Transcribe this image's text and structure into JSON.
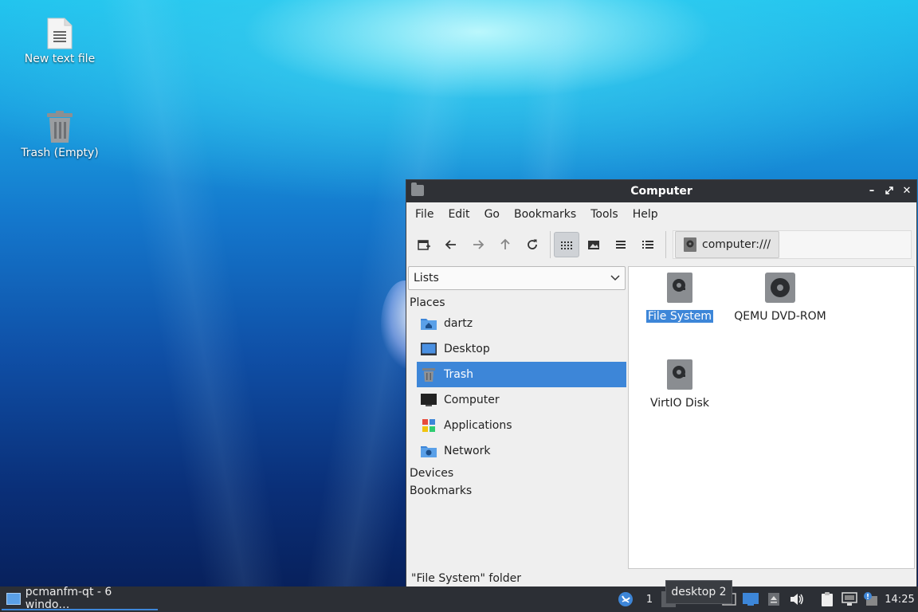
{
  "desktop": {
    "icons": [
      {
        "label": "New text file",
        "icon": "text-file-icon"
      },
      {
        "label": "Trash (Empty)",
        "icon": "trash-icon"
      }
    ]
  },
  "window": {
    "title": "Computer",
    "menu": [
      "File",
      "Edit",
      "Go",
      "Bookmarks",
      "Tools",
      "Help"
    ],
    "path": "computer:///",
    "sidebar": {
      "combo": "Lists",
      "places_header": "Places",
      "places": [
        {
          "label": "dartz",
          "icon": "home-folder-icon",
          "selected": false
        },
        {
          "label": "Desktop",
          "icon": "desktop-icon",
          "selected": false
        },
        {
          "label": "Trash",
          "icon": "trash-icon",
          "selected": true
        },
        {
          "label": "Computer",
          "icon": "computer-icon",
          "selected": false
        },
        {
          "label": "Applications",
          "icon": "applications-icon",
          "selected": false
        },
        {
          "label": "Network",
          "icon": "network-folder-icon",
          "selected": false
        }
      ],
      "devices_header": "Devices",
      "bookmarks_header": "Bookmarks"
    },
    "files": [
      {
        "label": "File System",
        "icon": "drive-icon",
        "selected": true
      },
      {
        "label": "QEMU DVD-ROM",
        "icon": "optical-drive-icon",
        "selected": false
      },
      {
        "label": "VirtIO Disk",
        "icon": "drive-icon",
        "selected": false
      }
    ],
    "status": "\"File System\" folder"
  },
  "taskbar": {
    "task_label": "pcmanfm-qt - 6 windo…",
    "desktop_number": "1",
    "tooltip": "desktop 2",
    "clock": "14:25"
  },
  "colors": {
    "selection": "#3d86d8",
    "titlebar": "#2f3136",
    "taskbar": "#2c2f35"
  }
}
